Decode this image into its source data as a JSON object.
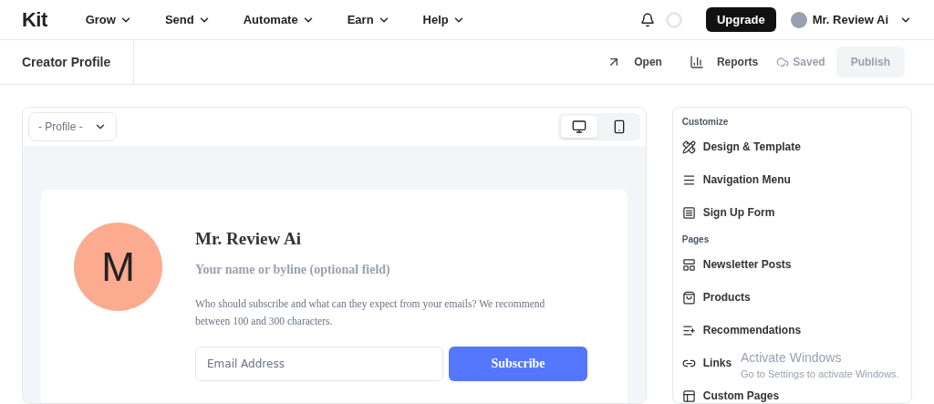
{
  "brand": {
    "logo": "Kit"
  },
  "nav": [
    {
      "label": "Grow"
    },
    {
      "label": "Send"
    },
    {
      "label": "Automate"
    },
    {
      "label": "Earn"
    },
    {
      "label": "Help"
    }
  ],
  "top_actions": {
    "upgrade": "Upgrade",
    "user_name": "Mr. Review Ai"
  },
  "page_bar": {
    "title": "Creator Profile",
    "open": "Open",
    "reports": "Reports",
    "saved": "Saved",
    "publish": {
      "label": "Publish",
      "disabled": true
    }
  },
  "preview": {
    "page_select": "- Profile -",
    "devices": [
      {
        "kind": "desktop",
        "selected": true
      },
      {
        "kind": "mobile",
        "selected": false
      }
    ],
    "profile": {
      "avatar_letter": "M",
      "name": "Mr. Review Ai",
      "byline": "Your name or byline (optional field)",
      "description": "Who should subscribe and what can they expect from your emails? We recommend between 100 and 300 characters.",
      "email_placeholder": "Email Address",
      "subscribe": "Subscribe"
    }
  },
  "sidebar": {
    "sections": [
      {
        "title": "Customize",
        "items": [
          {
            "kind": "design",
            "label": "Design & Template"
          },
          {
            "kind": "navigation",
            "label": "Navigation Menu"
          },
          {
            "kind": "form",
            "label": "Sign Up Form"
          }
        ]
      },
      {
        "title": "Pages",
        "items": [
          {
            "kind": "posts",
            "label": "Newsletter Posts"
          },
          {
            "kind": "products",
            "label": "Products"
          },
          {
            "kind": "recommendations",
            "label": "Recommendations"
          },
          {
            "kind": "links",
            "label": "Links"
          },
          {
            "kind": "custom",
            "label": "Custom Pages"
          }
        ]
      }
    ]
  },
  "os_notice": {
    "title": "Activate Windows",
    "subtitle": "Go to Settings to activate Windows."
  }
}
